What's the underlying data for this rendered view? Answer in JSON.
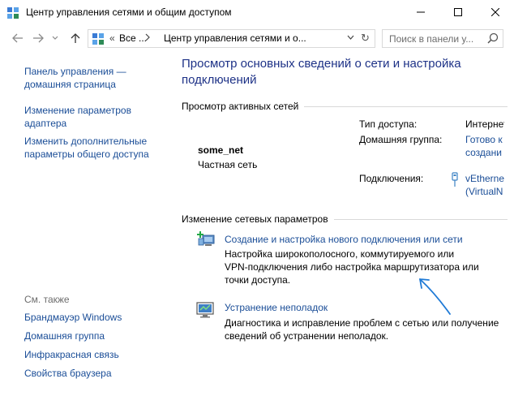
{
  "window": {
    "title": "Центр управления сетями и общим доступом",
    "controls": {
      "minimize": "─",
      "maximize": "☐",
      "close": "✕"
    }
  },
  "nav": {
    "back": "←",
    "forward": "→",
    "recent": "⌄",
    "up": "↑",
    "address": {
      "chevron": "«",
      "segment1": "Все ...",
      "arrow": "›",
      "segment2": "Центр управления сетями и о...",
      "dropdown": "⌄",
      "refresh": "↻"
    },
    "search": {
      "placeholder": "Поиск в панели у..."
    }
  },
  "sidebar": {
    "links": [
      {
        "line1": "Панель управления —",
        "line2": "домашняя страница"
      },
      {
        "line1": "Изменение параметров",
        "line2": "адаптера"
      },
      {
        "line1": "Изменить дополнительные",
        "line2": "параметры общего доступа"
      }
    ],
    "see_also_title": "См. также",
    "see_also": [
      "Брандмауэр Windows",
      "Домашняя группа",
      "Инфракрасная связь",
      "Свойства браузера"
    ]
  },
  "main": {
    "heading_line1": "Просмотр основных сведений о сети и настройка",
    "heading_line2": "подключений",
    "active_title": "Просмотр активных сетей",
    "network": {
      "name": "some_net",
      "type": "Частная сеть",
      "access_label": "Тип доступа:",
      "access_value": "Интернет",
      "homegroup_label": "Домашняя группа:",
      "homegroup_value_1": "Готово к",
      "homegroup_value_2": "создани",
      "connections_label": "Подключения:",
      "connection_value_1": "vEthernet",
      "connection_value_2": "(VirtualN"
    },
    "change_title": "Изменение сетевых параметров",
    "actions": [
      {
        "title": "Создание и настройка нового подключения или сети",
        "desc1": "Настройка широкополосного, коммутируемого или",
        "desc2": "VPN-подключения либо настройка маршрутизатора или",
        "desc3": "точки доступа."
      },
      {
        "title": "Устранение неполадок",
        "desc1": "Диагностика и исправление проблем с сетью или получение",
        "desc2": "сведений об устранении неполадок."
      }
    ]
  },
  "colors": {
    "link": "#1a4d97",
    "heading": "#1e3287",
    "annotation_arrow": "#1f7ad6"
  }
}
